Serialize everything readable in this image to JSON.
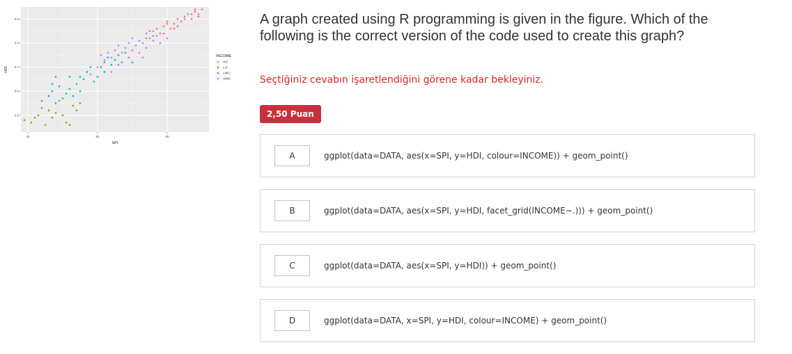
{
  "question": {
    "title_line1": "A graph created using R programming is given in the figure. Which of the",
    "title_line2": "following is the correct version of the code used to create this graph?",
    "wait_message": "Seçtiğiniz cevabın işaretlendiğini görene kadar bekleyiniz.",
    "points_badge": "2,50 Puan"
  },
  "options": [
    {
      "letter": "A",
      "text": "ggplot(data=DATA, aes(x=SPI, y=HDI, colour=INCOME)) + geom_point()"
    },
    {
      "letter": "B",
      "text": "ggplot(data=DATA, aes(x=SPI, y=HDI, facet_grid(INCOME~.))) + geom_point()"
    },
    {
      "letter": "C",
      "text": "ggplot(data=DATA, aes(x=SPI, y=HDI)) + geom_point()"
    },
    {
      "letter": "D",
      "text": "ggplot(data=DATA, x=SPI, y=HDI, colour=INCOME) + geom_point()"
    }
  ],
  "chart_data": {
    "type": "scatter",
    "xlabel": "SPI",
    "ylabel": "HDI",
    "xlim": [
      38,
      92
    ],
    "ylim": [
      0.43,
      0.95
    ],
    "x_ticks": [
      "40",
      "60",
      "80"
    ],
    "x_tick_values": [
      40,
      60,
      80
    ],
    "y_ticks": [
      "0.5",
      "0.6",
      "0.7",
      "0.8",
      "0.9"
    ],
    "y_tick_values": [
      0.5,
      0.6,
      0.7,
      0.8,
      0.9
    ],
    "grid": true,
    "legend_title": "INCOME",
    "legend_position": "right",
    "series": [
      {
        "name": "HIC",
        "color": "#f8766d",
        "points": [
          [
            75,
            0.85
          ],
          [
            77,
            0.86
          ],
          [
            79,
            0.87
          ],
          [
            80,
            0.88
          ],
          [
            81,
            0.86
          ],
          [
            82,
            0.88
          ],
          [
            83,
            0.9
          ],
          [
            84,
            0.89
          ],
          [
            85,
            0.91
          ],
          [
            86,
            0.92
          ],
          [
            87,
            0.9
          ],
          [
            88,
            0.93
          ],
          [
            89,
            0.92
          ],
          [
            90,
            0.94
          ],
          [
            78,
            0.84
          ],
          [
            80,
            0.89
          ],
          [
            83,
            0.87
          ],
          [
            85,
            0.9
          ],
          [
            87,
            0.92
          ],
          [
            89,
            0.91
          ],
          [
            76,
            0.83
          ],
          [
            74,
            0.82
          ],
          [
            88,
            0.94
          ],
          [
            82,
            0.86
          ]
        ]
      },
      {
        "name": "LIC",
        "color": "#7cae00",
        "points": [
          [
            39,
            0.48
          ],
          [
            41,
            0.47
          ],
          [
            43,
            0.5
          ],
          [
            44,
            0.53
          ],
          [
            45,
            0.46
          ],
          [
            46,
            0.52
          ],
          [
            47,
            0.49
          ],
          [
            48,
            0.51
          ],
          [
            50,
            0.5
          ],
          [
            51,
            0.47
          ],
          [
            53,
            0.54
          ],
          [
            54,
            0.52
          ],
          [
            55,
            0.55
          ],
          [
            49,
            0.56
          ],
          [
            52,
            0.46
          ],
          [
            42,
            0.49
          ]
        ]
      },
      {
        "name": "LMIC",
        "color": "#00bfc4",
        "points": [
          [
            44,
            0.56
          ],
          [
            46,
            0.58
          ],
          [
            47,
            0.6
          ],
          [
            48,
            0.55
          ],
          [
            49,
            0.62
          ],
          [
            50,
            0.57
          ],
          [
            51,
            0.59
          ],
          [
            52,
            0.61
          ],
          [
            53,
            0.58
          ],
          [
            54,
            0.63
          ],
          [
            55,
            0.6
          ],
          [
            56,
            0.65
          ],
          [
            57,
            0.68
          ],
          [
            58,
            0.7
          ],
          [
            60,
            0.66
          ],
          [
            61,
            0.7
          ],
          [
            62,
            0.72
          ],
          [
            63,
            0.74
          ],
          [
            64,
            0.71
          ],
          [
            65,
            0.73
          ],
          [
            66,
            0.75
          ],
          [
            67,
            0.72
          ],
          [
            68,
            0.76
          ],
          [
            59,
            0.64
          ],
          [
            55,
            0.66
          ],
          [
            62,
            0.68
          ],
          [
            70,
            0.72
          ],
          [
            47,
            0.63
          ],
          [
            52,
            0.66
          ],
          [
            48,
            0.66
          ]
        ]
      },
      {
        "name": "UMIC",
        "color": "#c77cff",
        "points": [
          [
            60,
            0.7
          ],
          [
            62,
            0.73
          ],
          [
            63,
            0.76
          ],
          [
            64,
            0.74
          ],
          [
            65,
            0.77
          ],
          [
            66,
            0.79
          ],
          [
            67,
            0.76
          ],
          [
            68,
            0.78
          ],
          [
            69,
            0.8
          ],
          [
            70,
            0.77
          ],
          [
            71,
            0.79
          ],
          [
            72,
            0.81
          ],
          [
            73,
            0.8
          ],
          [
            74,
            0.78
          ],
          [
            75,
            0.82
          ],
          [
            76,
            0.81
          ],
          [
            77,
            0.83
          ],
          [
            78,
            0.8
          ],
          [
            66,
            0.71
          ],
          [
            69,
            0.74
          ],
          [
            72,
            0.76
          ],
          [
            61,
            0.75
          ],
          [
            70,
            0.82
          ],
          [
            74,
            0.84
          ],
          [
            79,
            0.84
          ],
          [
            80,
            0.82
          ],
          [
            58,
            0.67
          ],
          [
            64,
            0.68
          ],
          [
            73,
            0.74
          ],
          [
            76,
            0.85
          ]
        ]
      }
    ]
  }
}
